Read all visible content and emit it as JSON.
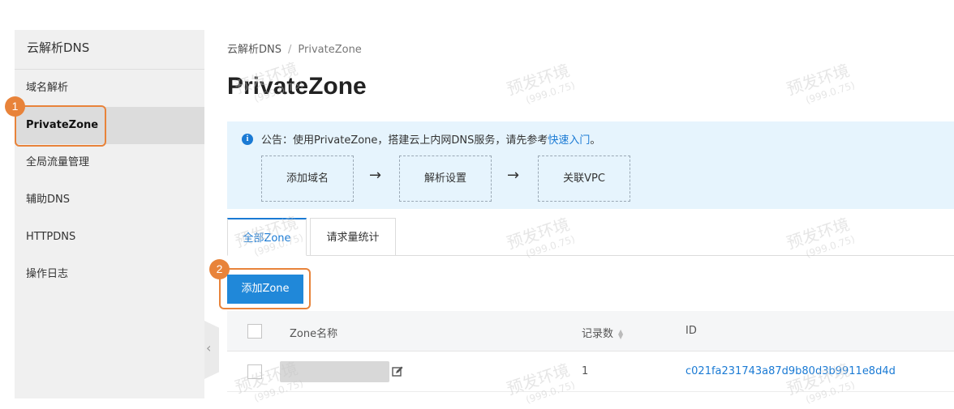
{
  "sidebar": {
    "title": "云解析DNS",
    "items": [
      {
        "label": "域名解析"
      },
      {
        "label": "PrivateZone",
        "active": true
      },
      {
        "label": "全局流量管理"
      },
      {
        "label": "辅助DNS"
      },
      {
        "label": "HTTPDNS"
      },
      {
        "label": "操作日志"
      }
    ],
    "collapse_icon": "chevron-left-icon"
  },
  "callouts": [
    "1",
    "2"
  ],
  "breadcrumb": {
    "root": "云解析DNS",
    "separator": "/",
    "current": "PrivateZone"
  },
  "page": {
    "title": "PrivateZone"
  },
  "notice": {
    "icon": "info-icon",
    "text": "公告：使用PrivateZone，搭建云上内网DNS服务，请先参考",
    "link": "快速入门",
    "suffix": "。",
    "steps": [
      "添加域名",
      "解析设置",
      "关联VPC"
    ],
    "arrow": "→"
  },
  "tabs": [
    {
      "label": "全部Zone",
      "active": true
    },
    {
      "label": "请求量统计"
    }
  ],
  "actions": {
    "add_zone": "添加Zone"
  },
  "table": {
    "headers": {
      "name": "Zone名称",
      "records": "记录数",
      "id": "ID"
    },
    "rows": [
      {
        "name": "",
        "records": "1",
        "id": "c021fa231743a87d9b80d3b9911e8d4d"
      }
    ]
  },
  "watermark": {
    "text": "预发环境",
    "sub": "(999.0.75)"
  },
  "colors": {
    "accent": "#1a7ad4",
    "button": "#2088d9",
    "callout": "#e8833a",
    "notice_bg": "#e6f4fd"
  }
}
